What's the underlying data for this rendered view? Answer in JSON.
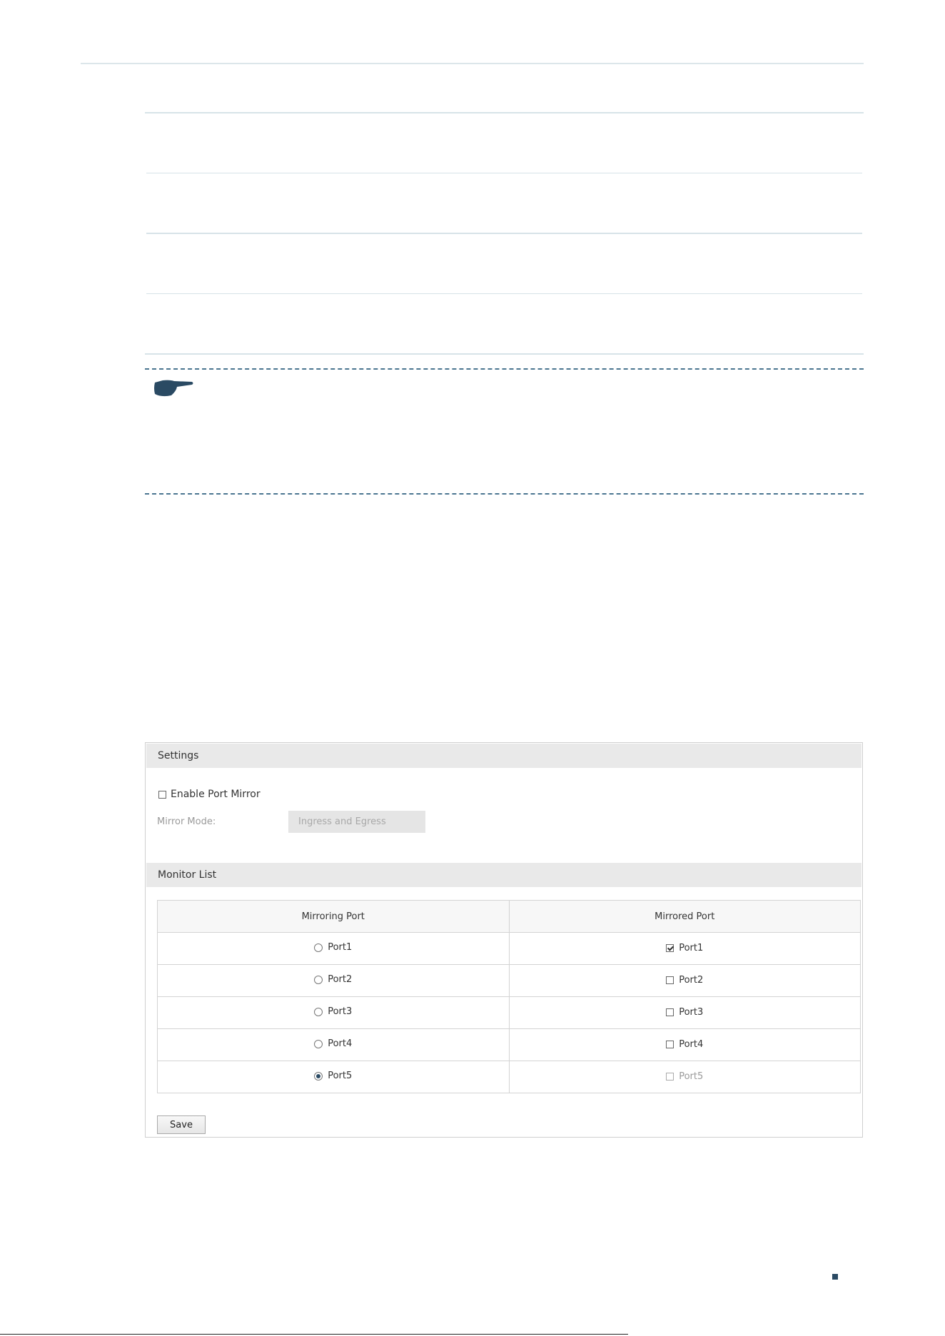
{
  "settings": {
    "section_title": "Settings",
    "enable_port_mirror": {
      "label": "Enable Port Mirror",
      "checked": false
    },
    "mirror_mode": {
      "label": "Mirror Mode:",
      "value": "Ingress and Egress",
      "disabled": true
    }
  },
  "monitor_list": {
    "section_title": "Monitor List",
    "columns": [
      "Mirroring Port",
      "Mirrored Port"
    ],
    "rows": [
      {
        "mirroring": {
          "label": "Port1",
          "selected": false
        },
        "mirrored": {
          "label": "Port1",
          "checked": true,
          "disabled": false
        }
      },
      {
        "mirroring": {
          "label": "Port2",
          "selected": false
        },
        "mirrored": {
          "label": "Port2",
          "checked": false,
          "disabled": false
        }
      },
      {
        "mirroring": {
          "label": "Port3",
          "selected": false
        },
        "mirrored": {
          "label": "Port3",
          "checked": false,
          "disabled": false
        }
      },
      {
        "mirroring": {
          "label": "Port4",
          "selected": false
        },
        "mirrored": {
          "label": "Port4",
          "checked": false,
          "disabled": false
        }
      },
      {
        "mirroring": {
          "label": "Port5",
          "selected": true
        },
        "mirrored": {
          "label": "Port5",
          "checked": false,
          "disabled": true
        }
      }
    ]
  },
  "actions": {
    "save_label": "Save"
  },
  "colors": {
    "rule": "#d7e3e8",
    "note_dash": "#4a7590",
    "note_icon": "#2a4a63",
    "section_bar": "#e9e9e9"
  },
  "icons": {
    "note": "pointing-hand-icon"
  }
}
